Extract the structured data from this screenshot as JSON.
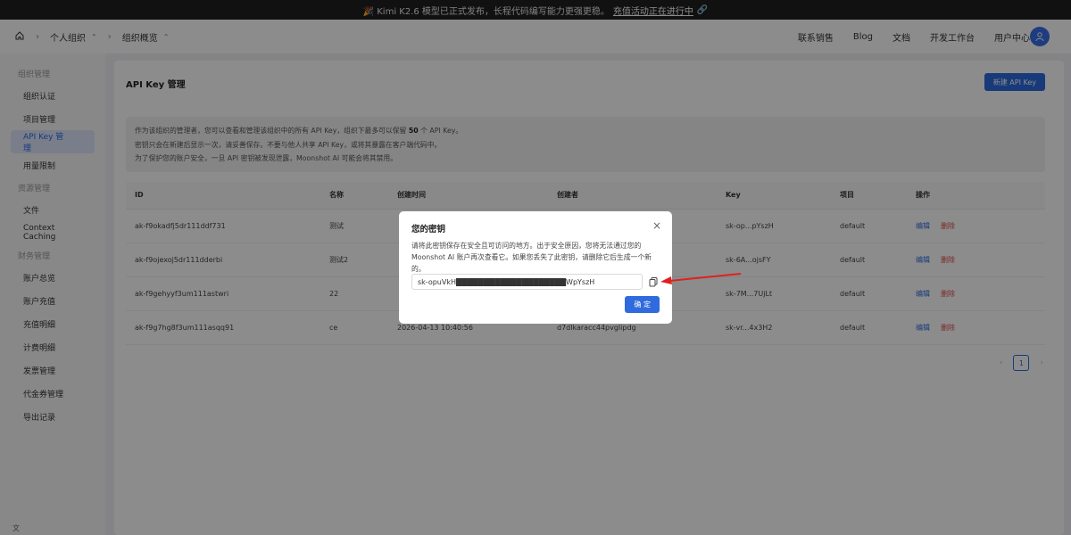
{
  "banner": {
    "text": "🎉 Kimi K2.6 模型已正式发布，长程代码编写能力更强更稳。",
    "link": "充值活动正在进行中"
  },
  "header": {
    "breadcrumb": [
      "个人组织",
      "组织概览"
    ],
    "nav": [
      "联系销售",
      "Blog",
      "文档",
      "开发工作台",
      "用户中心"
    ]
  },
  "sidebar": {
    "groups": [
      {
        "label": "组织管理",
        "items": [
          "组织认证",
          "项目管理",
          "API Key 管理",
          "用量限制"
        ]
      },
      {
        "label": "资源管理",
        "items": [
          "文件",
          "Context Caching"
        ]
      },
      {
        "label": "财务管理",
        "items": [
          "账户总览",
          "账户充值",
          "充值明细",
          "计费明细",
          "发票管理",
          "代金券管理",
          "导出记录"
        ]
      }
    ],
    "active": "API Key 管理",
    "bottom": "文"
  },
  "main": {
    "title": "API Key 管理",
    "new_button": "新建 API Key",
    "notice": {
      "line1_pre": "作为该组织的管理者，您可以查看和管理该组织中的所有 API Key，组织下最多可以保留",
      "line1_num": "50",
      "line1_post": "个 API Key。",
      "line2": "密钥只会在新建后显示一次，请妥善保存。不要与他人共享 API Key，或将其暴露在客户端代码中。",
      "line3": "为了保护您的账户安全，一旦 API 密钥被发现泄露，Moonshot AI 可能会将其禁用。"
    },
    "table": {
      "headers": [
        "ID",
        "名称",
        "创建时间",
        "创建者",
        "Key",
        "项目",
        "操作"
      ],
      "rows": [
        {
          "id": "ak-f9okadfj5dr111ddf731",
          "name": "测试",
          "created": "",
          "creator": "",
          "key": "sk-op...pYszH",
          "project": "default"
        },
        {
          "id": "ak-f9ojexoj5dr111dderbi",
          "name": "测试2",
          "created": "",
          "creator": "",
          "key": "sk-6A...ojsFY",
          "project": "default"
        },
        {
          "id": "ak-f9gehyyf3um111astwri",
          "name": "22",
          "created": "",
          "creator": "",
          "key": "sk-7M...7UjLt",
          "project": "default"
        },
        {
          "id": "ak-f9g7hg8f3um111asqq91",
          "name": "ce",
          "created": "2026-04-13 10:40:56",
          "creator": "d7dlkaracc44pvglipdg",
          "key": "sk-vr...4x3H2",
          "project": "default"
        }
      ],
      "edit": "编辑",
      "delete": "删除"
    },
    "pager": {
      "prev": "‹",
      "current": "1",
      "next": "›"
    }
  },
  "modal": {
    "title": "您的密钥",
    "close": "×",
    "desc": "请将此密钥保存在安全且可访问的地方。出于安全原因，您将无法通过您的 Moonshot AI 账户再次查看它。如果您丢失了此密钥，请删除它后生成一个新的。",
    "key_value": "sk-opuVkH████████████████████WpYszH",
    "ok": "确 定"
  },
  "colors": {
    "primary": "#2f6bde",
    "danger": "#e24a4a",
    "annotation": "#e02020"
  }
}
